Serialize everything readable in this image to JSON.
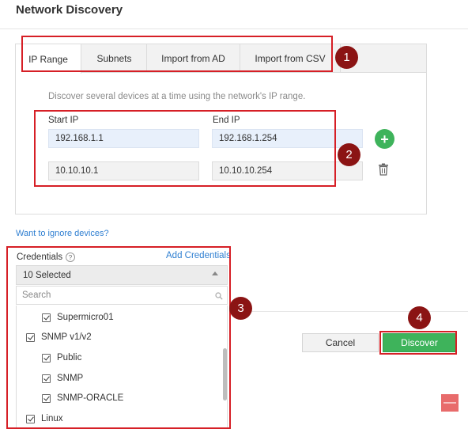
{
  "page": {
    "title": "Network Discovery"
  },
  "tabs": [
    {
      "label": "IP Range",
      "active": true
    },
    {
      "label": "Subnets"
    },
    {
      "label": "Import from AD"
    },
    {
      "label": "Import from CSV"
    }
  ],
  "ip_range": {
    "description": "Discover several devices at a time using the network's IP range.",
    "start_label": "Start IP",
    "end_label": "End IP",
    "rows": [
      {
        "start": "192.168.1.1",
        "end": "192.168.1.254"
      },
      {
        "start": "10.10.10.1",
        "end": "10.10.10.254"
      }
    ],
    "add_symbol": "+"
  },
  "ignore_link": "Want to ignore devices?",
  "credentials": {
    "label": "Credentials",
    "help_symbol": "?",
    "add_link": "Add Credentials",
    "selected": "10 Selected",
    "search_placeholder": "Search",
    "items": [
      {
        "label": "Supermicro01",
        "checked": true
      },
      {
        "label": "SNMP v1/v2",
        "checked": true
      },
      {
        "label": "Public",
        "checked": true
      },
      {
        "label": "SNMP",
        "checked": true
      },
      {
        "label": "SNMP-ORACLE",
        "checked": true
      },
      {
        "label": "Linux",
        "checked": true
      }
    ]
  },
  "actions": {
    "cancel": "Cancel",
    "discover": "Discover",
    "minimize_symbol": "—"
  },
  "annotations": [
    "1",
    "2",
    "3",
    "4"
  ],
  "colors": {
    "accent_green": "#3eb35b",
    "link_blue": "#2f7fd1",
    "annotation_red": "#d61f26",
    "badge_dark_red": "#8b1414"
  }
}
